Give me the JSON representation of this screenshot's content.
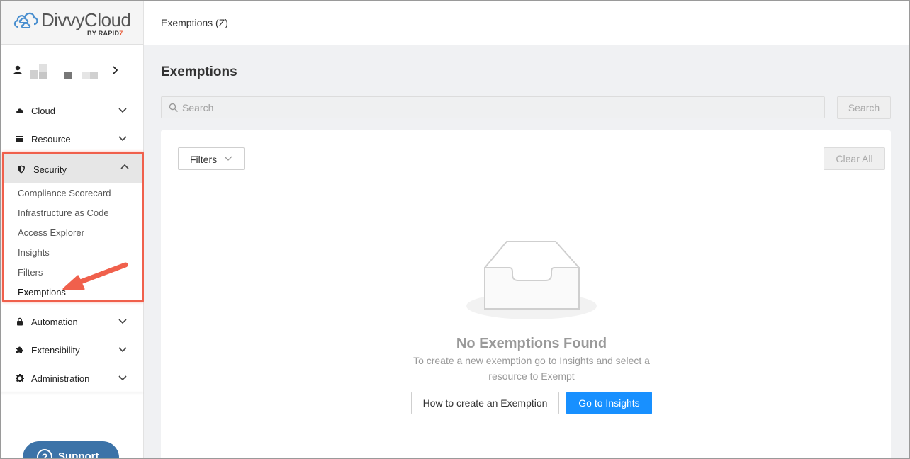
{
  "brand": {
    "name": "DivvyCloud",
    "byline_prefix": "BY ",
    "byline_rapid": "RAPID",
    "byline_suffix": "7",
    "accent": "#e85d3a"
  },
  "topbar": {
    "title": "Exemptions (Z)"
  },
  "sidebar": {
    "user_chevron": "›",
    "nav": [
      {
        "label": "Cloud",
        "icon": "cloud-icon"
      },
      {
        "label": "Resource",
        "icon": "list-icon"
      },
      {
        "label": "Security",
        "icon": "shield-icon",
        "expanded": true
      },
      {
        "label": "Automation",
        "icon": "lock-icon"
      },
      {
        "label": "Extensibility",
        "icon": "puzzle-icon"
      },
      {
        "label": "Administration",
        "icon": "gear-icon"
      }
    ],
    "security_items": [
      "Compliance Scorecard",
      "Infrastructure as Code",
      "Access Explorer",
      "Insights",
      "Filters",
      "Exemptions"
    ],
    "active_item": "Exemptions",
    "highlight_color": "#f0604c",
    "support_label": "Support",
    "support_glyph": "?"
  },
  "main": {
    "page_title": "Exemptions",
    "search_placeholder": "Search",
    "search_button": "Search",
    "filters_button": "Filters",
    "clear_button": "Clear All",
    "empty_title": "No Exemptions Found",
    "empty_desc": "To create a new exemption go to Insights and select a resource to Exempt",
    "how_button": "How to create an Exemption",
    "go_button": "Go to Insights",
    "primary_color": "#1890ff"
  }
}
